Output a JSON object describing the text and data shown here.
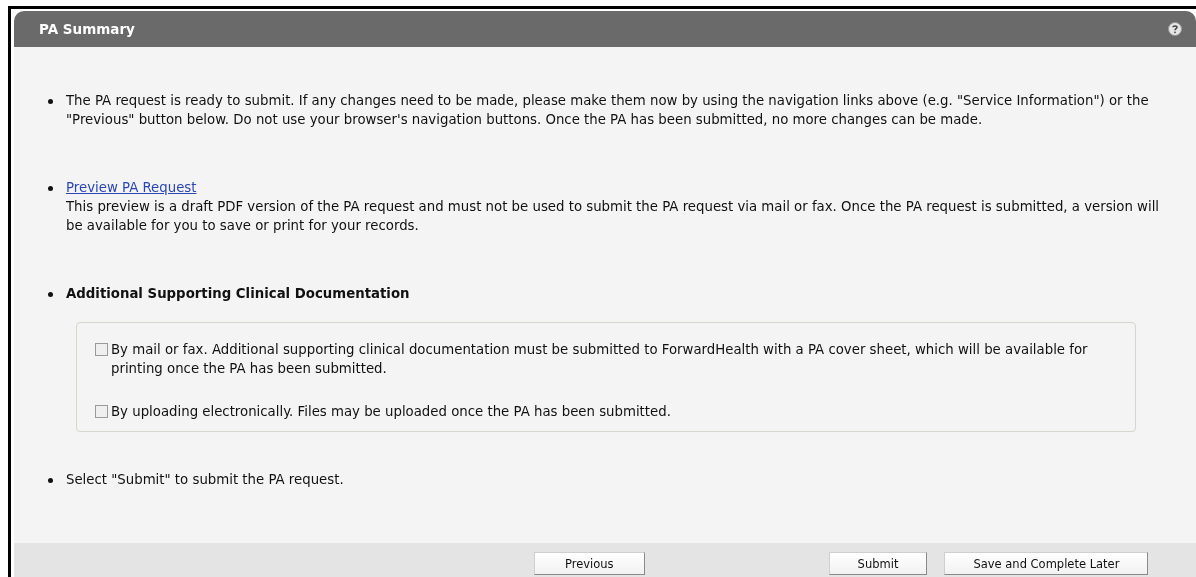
{
  "panel": {
    "title": "PA Summary"
  },
  "items": [
    {
      "kind": "text",
      "text": "The PA request is ready to submit. If any changes need to be made, please make them now by using the navigation links above (e.g. \"Service Information\") or the \"Previous\" button below. Do not use your browser's navigation buttons. Once the PA has been submitted, no more changes can be made."
    },
    {
      "kind": "link",
      "link": "Preview PA Request",
      "text": "This preview is a draft PDF version of the PA request and must not be used to submit the PA request via mail or fax. Once the PA request is submitted, a version will be available for you to save or print for your records."
    },
    {
      "kind": "options",
      "text": "Additional Supporting Clinical Documentation",
      "options": [
        {
          "label": "By mail or fax. Additional supporting clinical documentation must be submitted to ForwardHealth with a PA cover sheet, which will be available for printing once the PA has been submitted.",
          "checked": false
        },
        {
          "label": "By uploading electronically. Files may be uploaded once the PA has been submitted.",
          "checked": false
        }
      ]
    },
    {
      "kind": "text",
      "text": "Select \"Submit\" to submit the PA request."
    }
  ],
  "buttons": [
    {
      "label": "Previous"
    },
    {
      "label": "Submit"
    },
    {
      "label": "Save and Complete Later"
    }
  ]
}
